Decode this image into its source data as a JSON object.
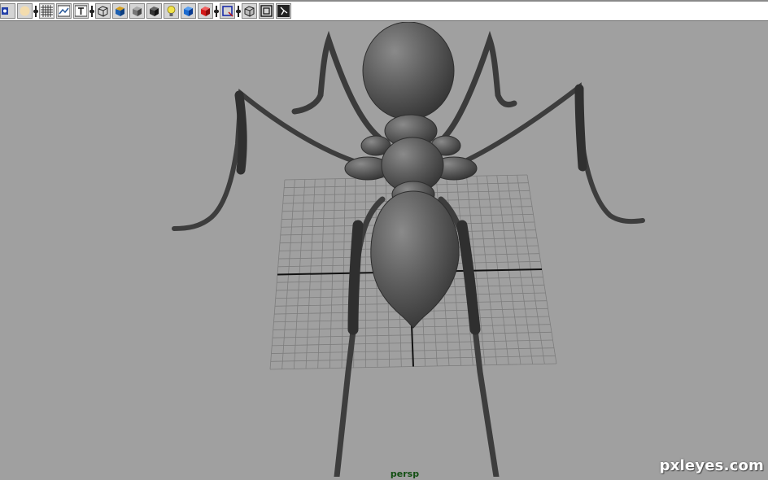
{
  "toolbar": {
    "buttons": [
      {
        "icon": "select-camera-icon"
      },
      {
        "icon": "lighting-sphere-icon"
      },
      {
        "icon": "grid-icon"
      },
      {
        "icon": "image-plane-icon"
      },
      {
        "icon": "texture-icon"
      },
      {
        "icon": "wireframe-cube-icon"
      },
      {
        "icon": "shaded-cube-icon"
      },
      {
        "icon": "smooth-shade-cube-icon"
      },
      {
        "icon": "flat-shade-cube-icon"
      },
      {
        "icon": "light-bulb-icon"
      },
      {
        "icon": "texture-cube-icon"
      },
      {
        "icon": "red-cube-icon"
      },
      {
        "icon": "resolution-gate-icon"
      },
      {
        "icon": "isolate-select-icon"
      },
      {
        "icon": "film-gate-icon"
      },
      {
        "icon": "xray-icon"
      }
    ]
  },
  "viewport": {
    "camera_label": "persp",
    "background_color": "#a0a0a0",
    "grid_color": "#7a7a7a",
    "axis_color": "#111111",
    "model_color": "#555555"
  },
  "watermark": {
    "text": "pxleyes.com"
  }
}
